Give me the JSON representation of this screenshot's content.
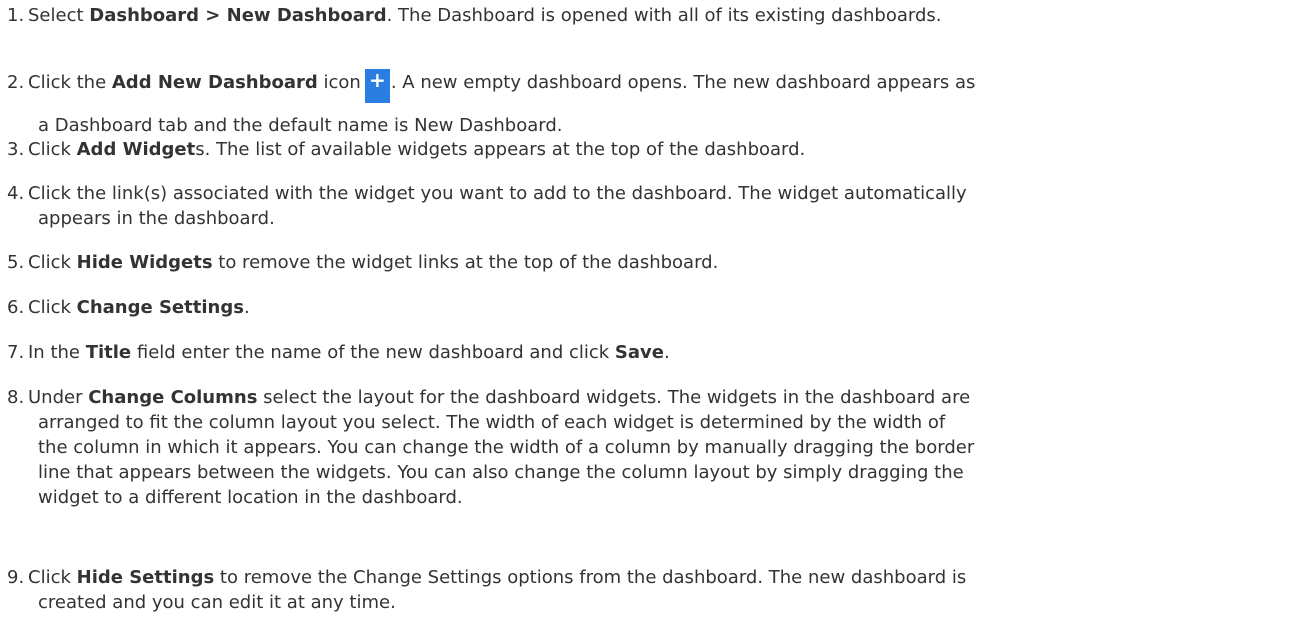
{
  "steps": [
    {
      "num": "1.",
      "pre": "Select ",
      "bold1": "Dashboard > New Dashboard",
      "post": ". The Dashboard is opened with all of its existing dashboards."
    },
    {
      "num": "2.",
      "pre": "Click the ",
      "bold1": "Add New Dashboard",
      "mid": " icon",
      "icon_glyph": "+",
      "post": ". A new empty dashboard opens. The new dashboard appears as",
      "cont": "a Dashboard tab and the default name is New Dashboard."
    },
    {
      "num": "3.",
      "pre": "Click ",
      "bold1": "Add Widget",
      "post": "s. The list of available widgets appears at the top of the dashboard."
    },
    {
      "num": "4.",
      "line1": "Click the link(s) associated with the widget you want to add to the dashboard. The widget automatically",
      "cont": "appears in the dashboard."
    },
    {
      "num": "5.",
      "pre": "Click ",
      "bold1": "Hide Widgets",
      "post": " to remove the widget links at the top of the dashboard."
    },
    {
      "num": "6.",
      "pre": "Click ",
      "bold1": "Change Settings",
      "post": "."
    },
    {
      "num": "7.",
      "pre": "In the ",
      "bold1": "Title",
      "mid": " field enter the name of the new dashboard and click ",
      "bold2": "Save",
      "post": "."
    },
    {
      "num": "8.",
      "pre": "Under ",
      "bold1": "Change Columns",
      "post": " select the layout for the dashboard widgets. The widgets in the dashboard are",
      "cont_lines": [
        "arranged to fit the column layout you select. The width of each widget is determined by the width of",
        "the column in which it appears. You can change the width of a column by manually dragging the border",
        "line that appears between the widgets. You can also change the column layout by simply dragging the",
        "widget to a different location in the dashboard."
      ]
    },
    {
      "num": "9.",
      "pre": "Click ",
      "bold1": "Hide Settings",
      "post": " to remove the Change Settings options from the dashboard. The new dashboard is",
      "cont": "created and you can edit it at any time."
    }
  ],
  "colors": {
    "text": "#333333",
    "icon_bg": "#2a7de1",
    "icon_fg": "#ffffff"
  },
  "icons": {
    "add_dashboard": "plus-icon"
  }
}
